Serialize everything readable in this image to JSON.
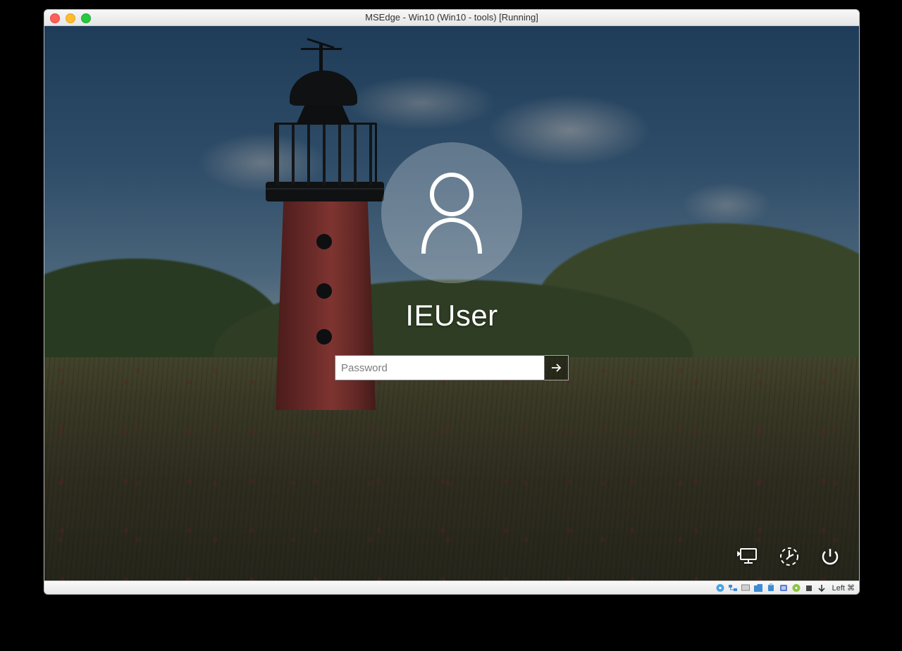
{
  "window": {
    "title": "MSEdge - Win10 (Win10 - tools) [Running]"
  },
  "login": {
    "username": "IEUser",
    "password_placeholder": "Password",
    "password_value": ""
  },
  "corner_buttons": {
    "network": "network-icon",
    "ease_of_access": "ease-of-access-icon",
    "power": "power-icon"
  },
  "statusbar": {
    "host_key": "Left ⌘",
    "indicators": [
      "hard-disk",
      "network",
      "display",
      "shared-folder",
      "usb",
      "audio",
      "cd",
      "recording",
      "host-key-arrow"
    ]
  }
}
